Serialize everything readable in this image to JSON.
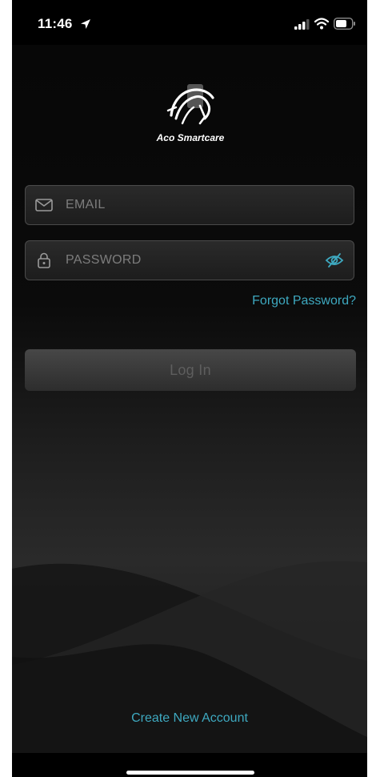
{
  "status_bar": {
    "time": "11:46",
    "icons": [
      "location-arrow-icon",
      "cellular-signal-icon",
      "wifi-icon",
      "battery-icon"
    ]
  },
  "brand": {
    "name": "Aco Smartcare",
    "logo_icon": "horse-head-icon"
  },
  "login_form": {
    "email": {
      "placeholder": "EMAIL",
      "value": "",
      "icon": "envelope-icon"
    },
    "password": {
      "placeholder": "PASSWORD",
      "value": "",
      "icon": "lock-icon",
      "toggle_icon": "eye-slash-icon"
    },
    "forgot_password_label": "Forgot Password?",
    "login_label": "Log In"
  },
  "footer": {
    "create_account_label": "Create New Account"
  },
  "colors": {
    "accent": "#3ea9c0",
    "background": "#0e0e0e",
    "field_border": "#4a4a4a",
    "button_disabled_text": "#5e5e5e"
  }
}
